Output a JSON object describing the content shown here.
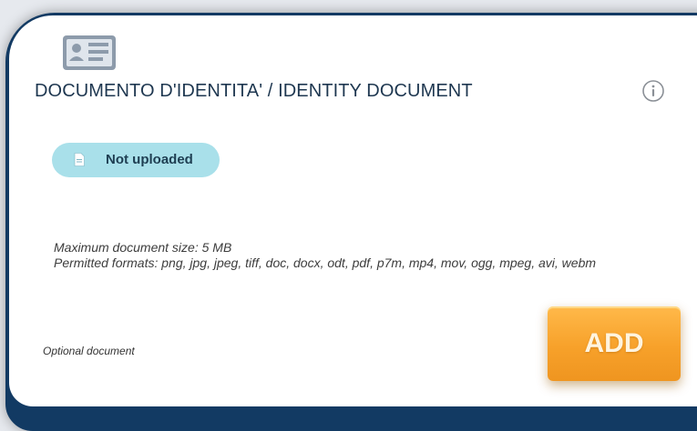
{
  "card": {
    "title": "DOCUMENTO D'IDENTITA' / IDENTITY DOCUMENT",
    "icon": "id-card-icon",
    "info_icon": "info-icon"
  },
  "status": {
    "icon": "document-icon",
    "label": "Not uploaded",
    "color": "#a9e0ea"
  },
  "requirements": {
    "max_size": "Maximum document size: 5 MB",
    "formats": "Permitted formats: png, jpg, jpeg, tiff, doc, docx, odt, pdf, p7m, mp4, mov, ogg, mpeg, avi, webm"
  },
  "optional_label": "Optional document",
  "add_button": {
    "label": "ADD",
    "color": "#f7a12a"
  },
  "colors": {
    "frame": "#123a63",
    "title": "#1e3750"
  }
}
